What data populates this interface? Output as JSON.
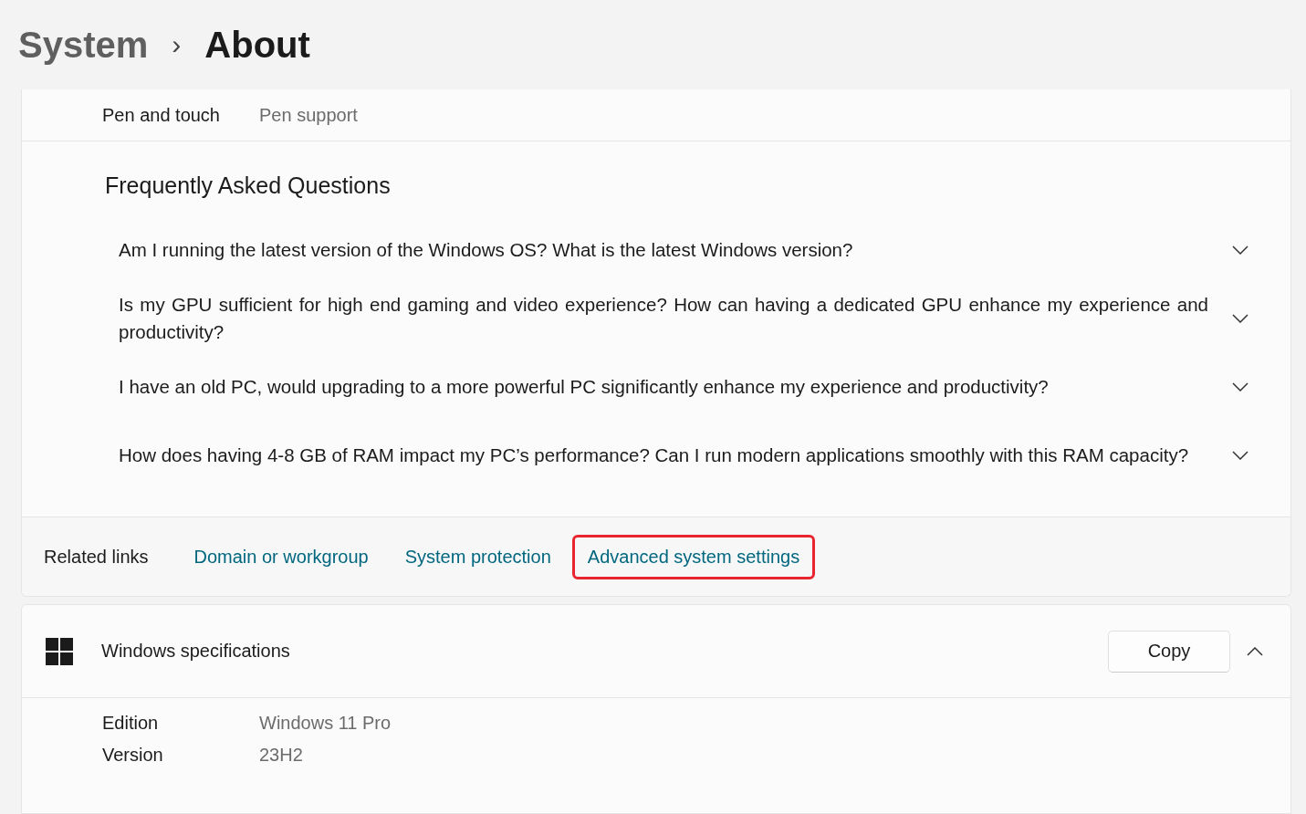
{
  "breadcrumb": {
    "parent": "System",
    "separator": "›",
    "current": "About"
  },
  "device_row": {
    "label": "Pen and touch",
    "value": "Pen support"
  },
  "faq": {
    "title": "Frequently Asked Questions",
    "questions": [
      {
        "text": "Am I running the latest version of the Windows OS? What is the latest Windows version?",
        "expanded": false
      },
      {
        "text": "Is my GPU sufficient for high end gaming and video experience? How can having a dedicated GPU enhance my experience and productivity?",
        "expanded": false
      },
      {
        "text": "I have an old PC, would upgrading to a more powerful PC significantly enhance my experience and productivity?",
        "expanded": false
      },
      {
        "text": "How does having 4-8 GB of RAM impact my PC’s performance? Can I run modern applications smoothly with this RAM capacity?",
        "expanded": false
      }
    ]
  },
  "related_links": {
    "label": "Related links",
    "links": [
      {
        "text": "Domain or workgroup",
        "highlighted": false
      },
      {
        "text": "System protection",
        "highlighted": false
      },
      {
        "text": "Advanced system settings",
        "highlighted": true
      }
    ]
  },
  "windows_specs": {
    "title": "Windows specifications",
    "copy_button": "Copy",
    "expanded": true,
    "rows": [
      {
        "label": "Edition",
        "value": "Windows 11 Pro"
      },
      {
        "label": "Version",
        "value": "23H2"
      }
    ]
  }
}
